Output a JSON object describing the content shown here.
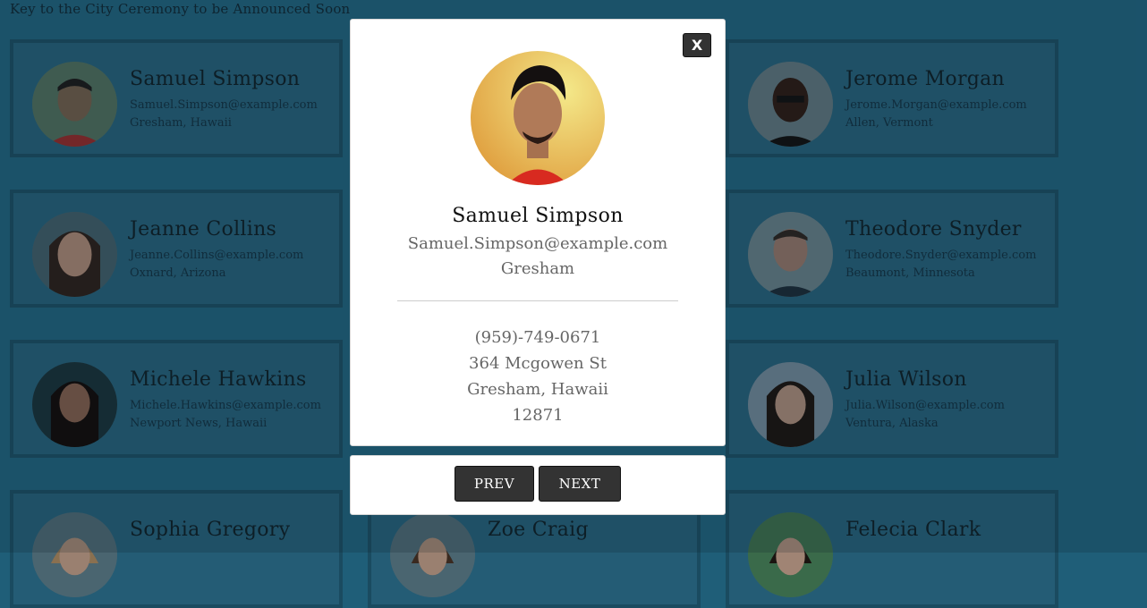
{
  "header": {
    "title": "Key to the City Ceremony to be Announced Soon"
  },
  "employees": [
    {
      "name": "Samuel Simpson",
      "email": "Samuel.Simpson@example.com",
      "location": "Gresham, Hawaii"
    },
    {
      "name": "Jeanne Collins",
      "email": "Jeanne.Collins@example.com",
      "location": "Oxnard, Arizona"
    },
    {
      "name": "Michele Hawkins",
      "email": "Michele.Hawkins@example.com",
      "location": "Newport News, Hawaii"
    },
    {
      "name": "Sophia Gregory",
      "email": "",
      "location": ""
    },
    {
      "name": "Zoe Craig",
      "email": "",
      "location": ""
    },
    {
      "name": "Jerome Morgan",
      "email": "Jerome.Morgan@example.com",
      "location": "Allen, Vermont"
    },
    {
      "name": "Theodore Snyder",
      "email": "Theodore.Snyder@example.com",
      "location": "Beaumont, Minnesota"
    },
    {
      "name": "Julia Wilson",
      "email": "Julia.Wilson@example.com",
      "location": "Ventura, Alaska"
    },
    {
      "name": "Felecia Clark",
      "email": "",
      "location": ""
    }
  ],
  "modal": {
    "close_label": "X",
    "name": "Samuel Simpson",
    "email": "Samuel.Simpson@example.com",
    "city": "Gresham",
    "phone": "(959)-749-0671",
    "street": "364 Mcgowen St",
    "city_state": "Gresham, Hawaii",
    "postcode": "12871",
    "prev_label": "PREV",
    "next_label": "NEXT"
  }
}
